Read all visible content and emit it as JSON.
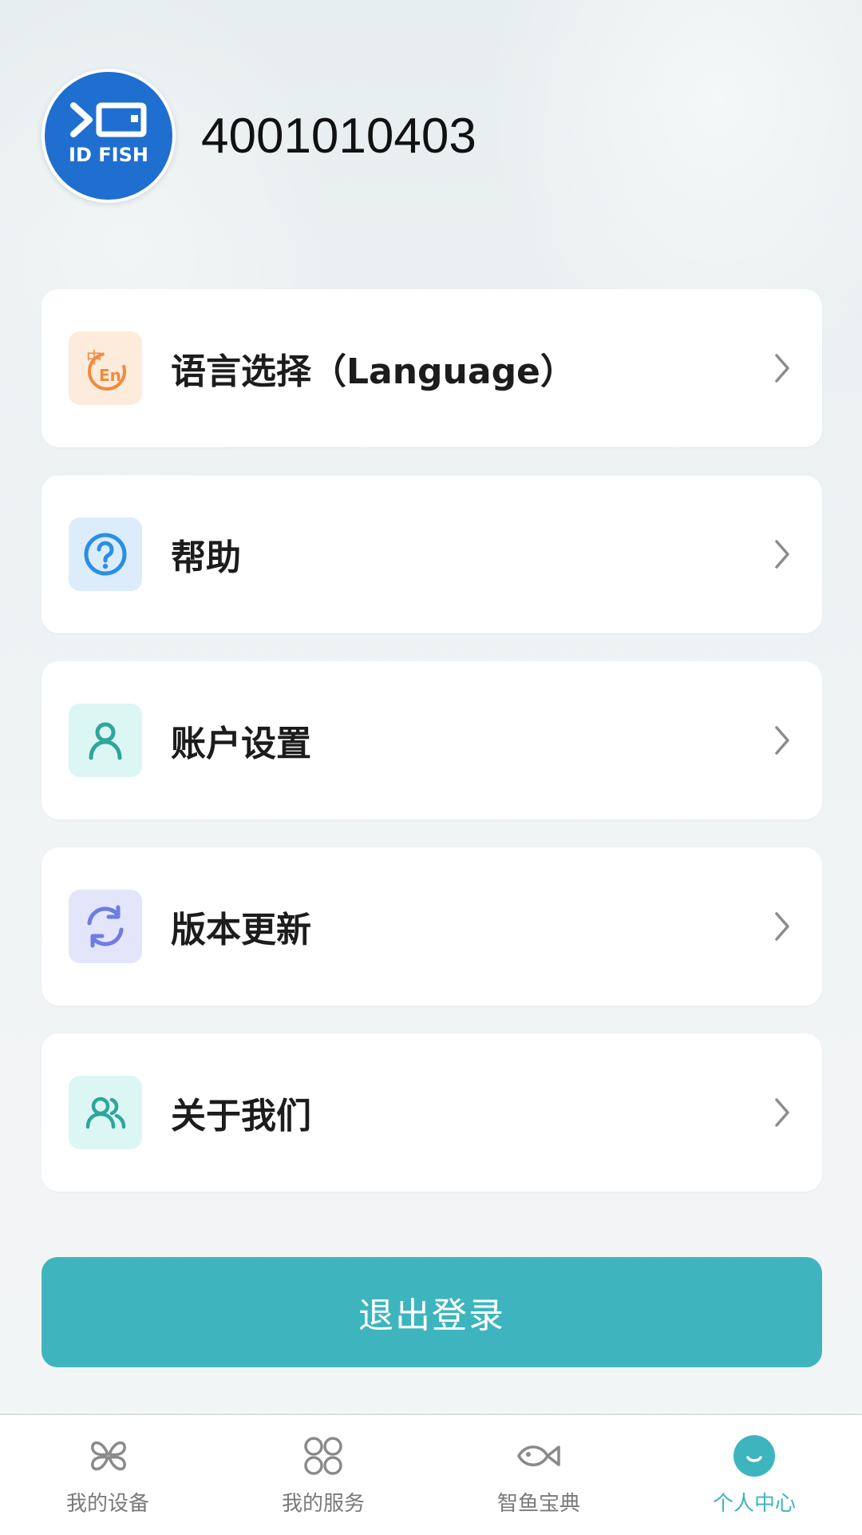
{
  "profile": {
    "username": "4001010403",
    "avatar_logo_text": "ID FISH"
  },
  "menu": {
    "items": [
      {
        "label": "语言选择（Language）",
        "icon": "language-zh-en-icon",
        "icon_text": "中En",
        "icon_bg": "#fdebdc",
        "icon_color": "#f28a3c"
      },
      {
        "label": "帮助",
        "icon": "help-question-icon",
        "icon_bg": "#dcecfb",
        "icon_color": "#2a8ee8"
      },
      {
        "label": "账户设置",
        "icon": "account-user-icon",
        "icon_bg": "#dcf6f4",
        "icon_color": "#2ea69b"
      },
      {
        "label": "版本更新",
        "icon": "refresh-update-icon",
        "icon_bg": "#e3e5fb",
        "icon_color": "#6f7be6"
      },
      {
        "label": "关于我们",
        "icon": "about-users-icon",
        "icon_bg": "#dcf6f4",
        "icon_color": "#2ea69b"
      }
    ]
  },
  "logout": {
    "label": "退出登录",
    "color": "#3eb5be"
  },
  "tabbar": {
    "items": [
      {
        "label": "我的设备",
        "icon": "device-clover-icon",
        "active": false
      },
      {
        "label": "我的服务",
        "icon": "service-grid-icon",
        "active": false
      },
      {
        "label": "智鱼宝典",
        "icon": "fish-icon",
        "active": false
      },
      {
        "label": "个人中心",
        "icon": "profile-smile-icon",
        "active": true
      }
    ],
    "active_color": "#3eb5be",
    "inactive_color": "#7a7a7a"
  }
}
